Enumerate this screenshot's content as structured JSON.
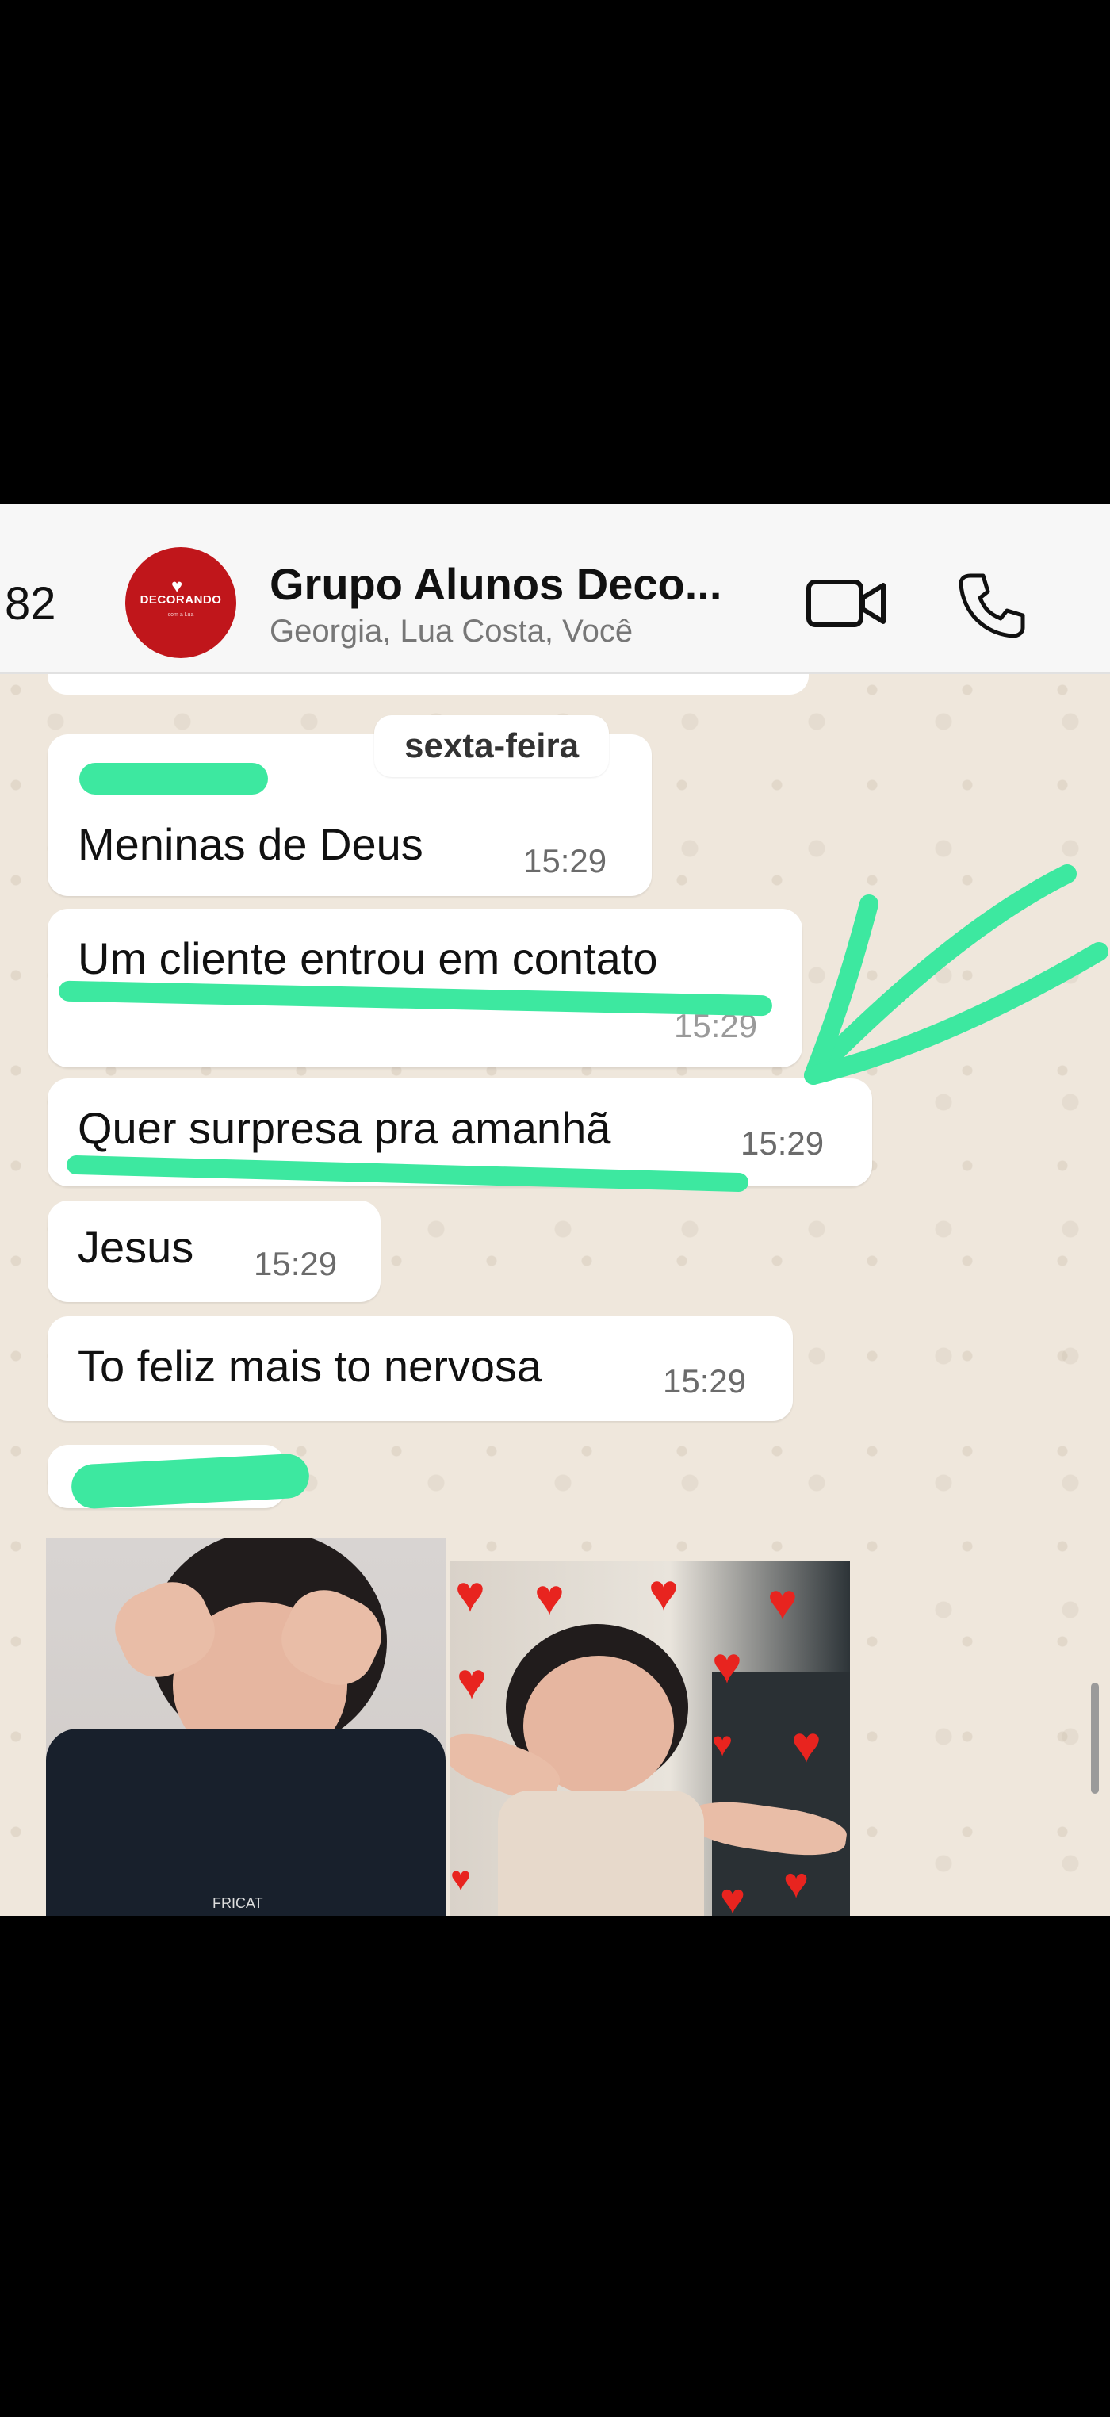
{
  "header": {
    "back_count": "82",
    "title": "Grupo Alunos Deco...",
    "subtitle": "Georgia, Lua Costa, Você",
    "avatar_text": "DECORANDO",
    "avatar_sub": "com a Lua"
  },
  "chat": {
    "date_chip": "sexta-feira",
    "messages": [
      {
        "text": "Meninas de Deus",
        "time": "15:29"
      },
      {
        "text": "Um cliente entrou em contato",
        "time": "15:29"
      },
      {
        "text": "Quer surpresa pra amanhã",
        "time": "15:29"
      },
      {
        "text": "Jesus",
        "time": "15:29"
      },
      {
        "text": "To feliz mais to nervosa",
        "time": "15:29"
      }
    ],
    "photo1_shirt_text": "FRICAT"
  },
  "colors": {
    "marker": "#3de8a0",
    "chat_background": "#efe7dc",
    "avatar_red": "#c0161b"
  },
  "icons": [
    "video-call-icon",
    "phone-call-icon"
  ]
}
